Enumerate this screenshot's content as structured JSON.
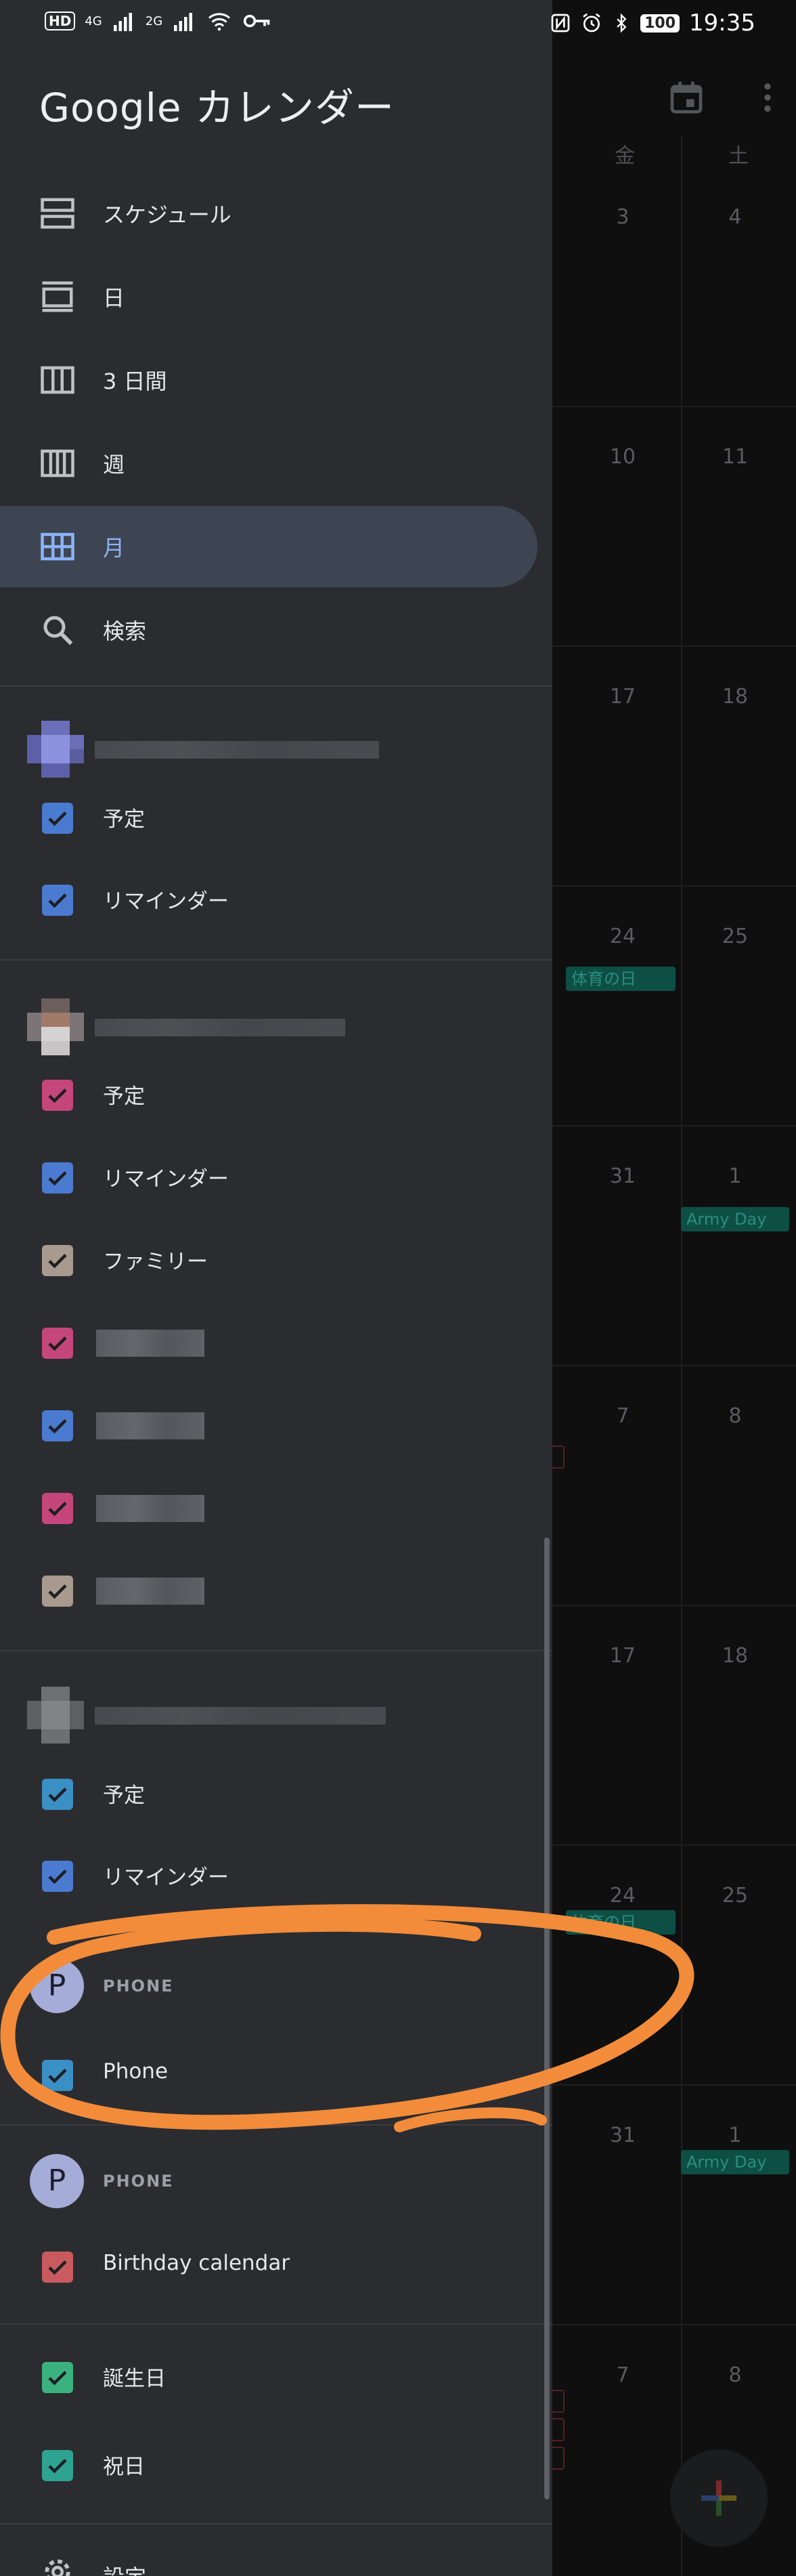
{
  "status_bar": {
    "left_badges": [
      "HD",
      "4G",
      "2G"
    ],
    "battery": "100",
    "time": "19:35"
  },
  "drawer": {
    "app_title": "Google カレンダー",
    "views": [
      {
        "label": "スケジュール",
        "icon": "schedule-view-icon"
      },
      {
        "label": "日",
        "icon": "day-view-icon"
      },
      {
        "label": "3 日間",
        "icon": "three-day-view-icon"
      },
      {
        "label": "週",
        "icon": "week-view-icon"
      },
      {
        "label": "月",
        "icon": "month-view-icon",
        "active": true
      },
      {
        "label": "検索",
        "icon": "search-icon"
      }
    ],
    "account1": {
      "calendars": [
        {
          "label": "予定",
          "color": "#4a7bd0",
          "checked": true
        },
        {
          "label": "リマインダー",
          "color": "#4a7bd0",
          "checked": true
        }
      ]
    },
    "account2": {
      "calendars": [
        {
          "label": "予定",
          "color": "#c5467a",
          "checked": true
        },
        {
          "label": "リマインダー",
          "color": "#4a7bd0",
          "checked": true
        },
        {
          "label": "ファミリー",
          "color": "#a89a8e",
          "checked": true
        },
        {
          "label": "",
          "color": "#c5467a",
          "checked": true
        },
        {
          "label": "",
          "color": "#4a7bd0",
          "checked": true
        },
        {
          "label": "",
          "color": "#c5467a",
          "checked": true
        },
        {
          "label": "",
          "color": "#a89a8e",
          "checked": true
        }
      ]
    },
    "account3": {
      "calendars": [
        {
          "label": "予定",
          "color": "#3a8fc5",
          "checked": true
        },
        {
          "label": "リマインダー",
          "color": "#4a7bd0",
          "checked": true
        }
      ]
    },
    "phone1": {
      "avatar_letter": "P",
      "header": "PHONE",
      "calendar": {
        "label": "Phone",
        "color": "#3a8fc5",
        "checked": true
      }
    },
    "phone2": {
      "avatar_letter": "P",
      "header": "PHONE",
      "calendar": {
        "label": "Birthday calendar",
        "color": "#c95a5f",
        "checked": true
      }
    },
    "other": [
      {
        "label": "誕生日",
        "color": "#3bb27d",
        "checked": true
      },
      {
        "label": "祝日",
        "color": "#2fa391",
        "checked": true
      }
    ],
    "settings_label": "設定"
  },
  "background_calendar": {
    "day_headers": [
      "金",
      "土"
    ],
    "weeks": [
      [
        "3",
        "4"
      ],
      [
        "10",
        "11"
      ],
      [
        "17",
        "18"
      ],
      [
        "24",
        "25"
      ],
      [
        "31",
        "1"
      ],
      [
        "7",
        "8"
      ],
      [
        "17",
        "18"
      ],
      [
        "24",
        "25"
      ],
      [
        "31",
        "1"
      ],
      [
        "7",
        "8"
      ]
    ],
    "events": {
      "sports_day_1": "体育の日",
      "army_day_1": "Army Day",
      "sports_day_2": "体育の日",
      "army_day_2": "Army Day"
    }
  },
  "colors": {
    "drawer_bg": "#2b2c30",
    "active_bg": "#3d4552",
    "accent_blue": "#8ab4f8",
    "annotation_orange": "#f28c3a"
  }
}
